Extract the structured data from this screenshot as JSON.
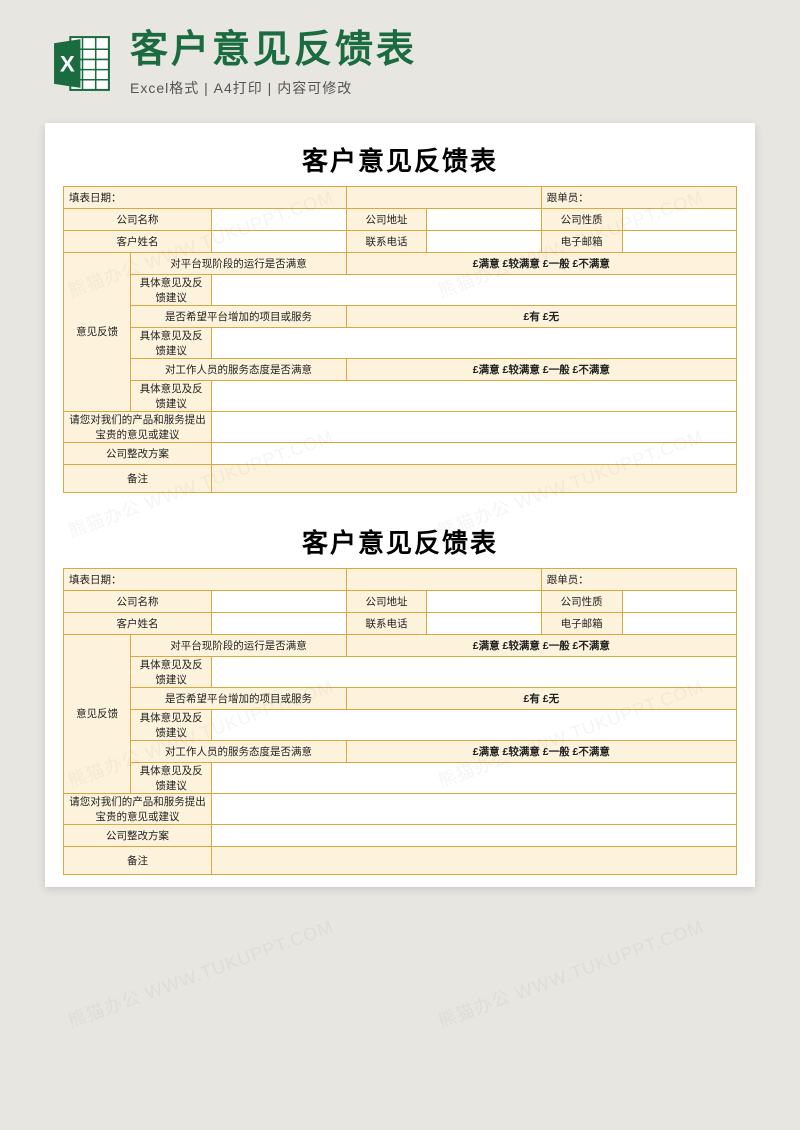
{
  "header": {
    "main_title": "客户意见反馈表",
    "sub_title": "Excel格式 | A4打印 | 内容可修改",
    "icon_name": "excel-file-icon"
  },
  "form": {
    "title": "客户意见反馈表",
    "row_date": {
      "fill_date": "填表日期：",
      "follower": "跟单员："
    },
    "row_company": {
      "name": "公司名称",
      "addr": "公司地址",
      "nature": "公司性质"
    },
    "row_customer": {
      "name": "客户姓名",
      "phone": "联系电话",
      "email": "电子邮箱"
    },
    "feedback_section": "意见反馈",
    "q1": "对平台现阶段的运行是否满意",
    "q2": "是否希望平台增加的项目或服务",
    "q3": "对工作人员的服务态度是否满意",
    "detail_label": "具体意见及反馈建议",
    "opts_satisfaction": "£满意 £较满意 £一般 £不满意",
    "opts_yesno": "£有 £无",
    "suggestion_label": "请您对我们的产品和服务提出宝贵的意见或建议",
    "plan_label": "公司整改方案",
    "remark_label": "备注"
  },
  "watermark_text": "熊猫办公 WWW.TUKUPPT.COM",
  "colors": {
    "accent": "#1a6b3f",
    "border": "#d9a842",
    "light": "#fdf3dd"
  }
}
